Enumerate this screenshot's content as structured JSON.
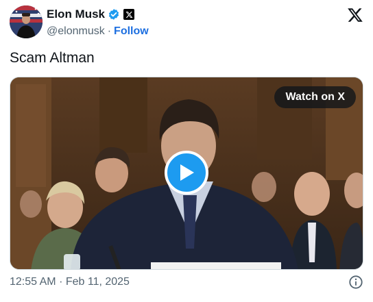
{
  "author": {
    "display_name": "Elon Musk",
    "handle": "@elonmusk",
    "separator": "·",
    "follow_label": "Follow"
  },
  "tweet": {
    "text": "Scam Altman"
  },
  "media": {
    "watch_label": "Watch on X"
  },
  "footer": {
    "time": "12:55 AM",
    "separator": "·",
    "date": "Feb 11, 2025"
  },
  "colors": {
    "accent": "#1d9bf0",
    "link": "#1d6fe0",
    "muted": "#536471"
  },
  "icons": [
    "verified-badge-icon",
    "x-affiliate-icon",
    "x-logo-icon",
    "play-icon",
    "info-icon"
  ]
}
